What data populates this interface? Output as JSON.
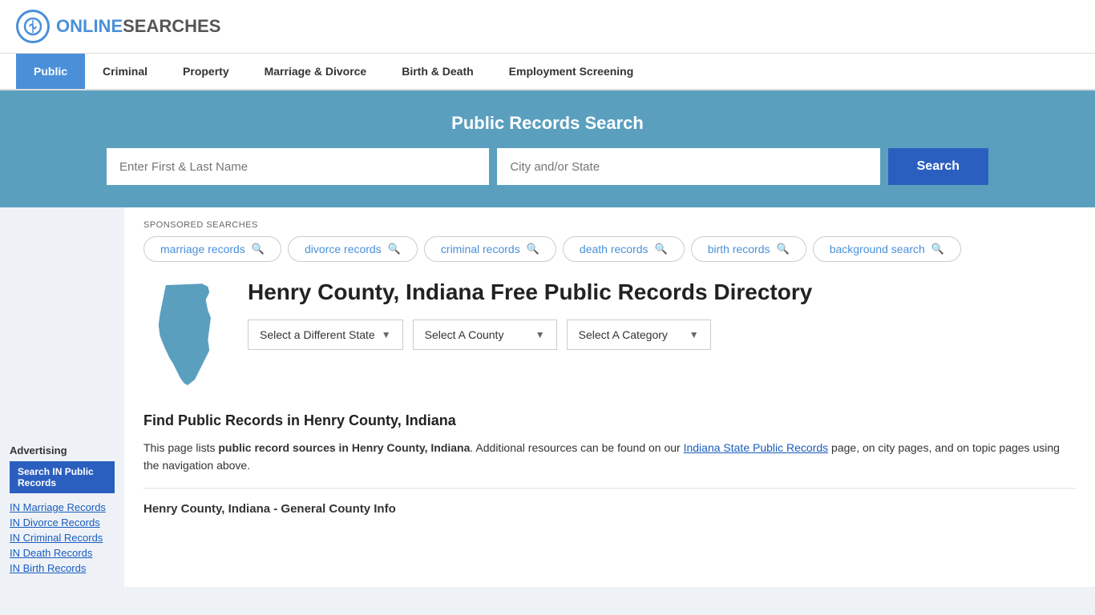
{
  "logo": {
    "online": "ONLINE",
    "searches": "SEARCHES"
  },
  "nav": {
    "items": [
      {
        "label": "Public",
        "active": true
      },
      {
        "label": "Criminal",
        "active": false
      },
      {
        "label": "Property",
        "active": false
      },
      {
        "label": "Marriage & Divorce",
        "active": false
      },
      {
        "label": "Birth & Death",
        "active": false
      },
      {
        "label": "Employment Screening",
        "active": false
      }
    ]
  },
  "search_banner": {
    "title": "Public Records Search",
    "name_placeholder": "Enter First & Last Name",
    "location_placeholder": "City and/or State",
    "button_label": "Search"
  },
  "sponsored": {
    "label": "SPONSORED SEARCHES",
    "tags": [
      "marriage records",
      "divorce records",
      "criminal records",
      "death records",
      "birth records",
      "background search"
    ]
  },
  "page": {
    "title": "Henry County, Indiana Free Public Records Directory",
    "dropdowns": {
      "state": "Select a Different State",
      "county": "Select A County",
      "category": "Select A Category"
    },
    "find_title": "Find Public Records in Henry County, Indiana",
    "find_body_1": "This page lists ",
    "find_body_bold": "public record sources in Henry County, Indiana",
    "find_body_2": ". Additional resources can be found on our ",
    "find_body_link": "Indiana State Public Records",
    "find_body_3": " page, on city pages, and on topic pages using the navigation above.",
    "general_info_title": "Henry County, Indiana - General County Info"
  },
  "sidebar": {
    "ad_label": "Advertising",
    "cta_label": "Search IN Public Records",
    "links": [
      "IN Marriage Records",
      "IN Divorce Records",
      "IN Criminal Records",
      "IN Death Records",
      "IN Birth Records"
    ]
  }
}
